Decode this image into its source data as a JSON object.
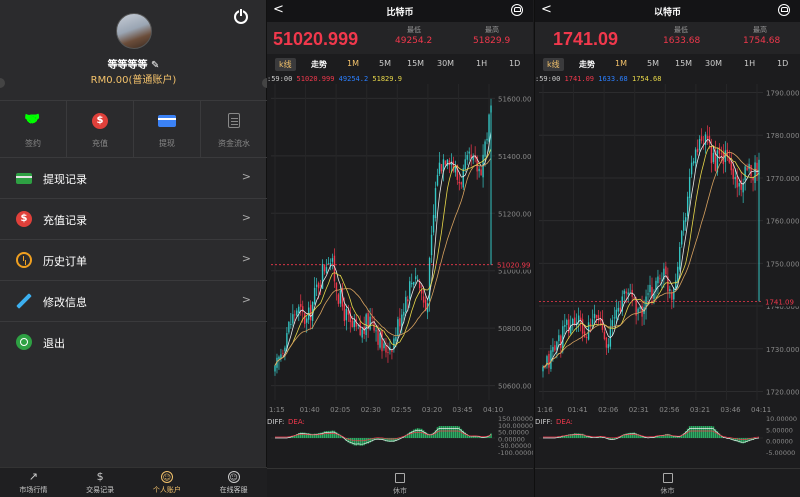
{
  "account": {
    "username": "等等等等 ✎",
    "balance": "RM0.00(普通账户)",
    "actions": [
      {
        "label": "签约",
        "icon": "handshake-icon"
      },
      {
        "label": "充值",
        "icon": "dollar-icon"
      },
      {
        "label": "提现",
        "icon": "card-icon"
      },
      {
        "label": "资金流水",
        "icon": "document-icon"
      }
    ],
    "menu": [
      {
        "label": "提现记录",
        "icon": "card-icon"
      },
      {
        "label": "充值记录",
        "icon": "dollar-icon"
      },
      {
        "label": "历史订单",
        "icon": "clock-icon"
      },
      {
        "label": "修改信息",
        "icon": "pen-icon"
      },
      {
        "label": "退出",
        "icon": "power-icon"
      }
    ],
    "chevron": ">",
    "tabs": [
      {
        "label": "市场行情",
        "glyph": "↗"
      },
      {
        "label": "交易记录",
        "glyph": "$"
      },
      {
        "label": "个人账户",
        "glyph": "☺",
        "active": true
      },
      {
        "label": "在线客服",
        "glyph": "☺"
      }
    ]
  },
  "panels": [
    {
      "back": "<",
      "title": "比特币",
      "price": "51020.999",
      "low_label": "最低",
      "low": "49254.2",
      "high_label": "最高",
      "high": "51829.9",
      "timeframes": [
        "k线",
        "走势",
        "1M",
        "5M",
        "15M",
        "30M",
        "1H",
        "1D"
      ],
      "active_timeframe": "1M",
      "legend": {
        "time": ":59:00",
        "a": "51020.999",
        "b": "49254.2",
        "c": "51829.9"
      },
      "bottom_label": "休市",
      "chart_data": {
        "type": "candlestick",
        "ylim": [
          50550,
          51650
        ],
        "y_ticks": [
          "51600.00",
          "51400.00",
          "51200.00",
          "51000.00",
          "50800.00",
          "50600.00"
        ],
        "x_ticks": [
          "1:15",
          "01:40",
          "02:05",
          "02:30",
          "02:55",
          "03:20",
          "03:45",
          "04:10"
        ],
        "last_price_label": "51020.99",
        "last_price": 51020.999,
        "macd_label": "DIFF:",
        "dea_label": "DEA:",
        "macd_ticks": [
          "150.00000",
          "100.00000",
          "50.00000",
          "0.00000",
          "-50.00000",
          "-100.00000"
        ],
        "path": [
          50640,
          50780,
          50870,
          50820,
          50960,
          51060,
          50900,
          50800,
          50780,
          50850,
          50720,
          50760,
          50900,
          51000,
          50860,
          51350,
          51420,
          51310,
          51380,
          51350,
          51560
        ]
      }
    },
    {
      "back": "<",
      "title": "以特币",
      "price": "1741.09",
      "low_label": "最低",
      "low": "1633.68",
      "high_label": "最高",
      "high": "1754.68",
      "timeframes": [
        "k线",
        "走势",
        "1M",
        "5M",
        "15M",
        "30M",
        "1H",
        "1D"
      ],
      "active_timeframe": "1M",
      "legend": {
        "time": ":59:00",
        "a": "1741.09",
        "b": "1633.68",
        "c": "1754.68"
      },
      "bottom_label": "休市",
      "chart_data": {
        "type": "candlestick",
        "ylim": [
          1718,
          1792
        ],
        "y_ticks": [
          "1790.000",
          "1780.000",
          "1770.000",
          "1760.000",
          "1750.000",
          "1740.000",
          "1730.000",
          "1720.000"
        ],
        "x_ticks": [
          "1:16",
          "01:41",
          "02:06",
          "02:31",
          "02:56",
          "03:21",
          "03:46",
          "04:11"
        ],
        "last_price_label": "1741.09",
        "last_price": 1741.09,
        "macd_label": "DIFF:",
        "dea_label": "DEA:",
        "macd_ticks": [
          "10.00000",
          "5.00000",
          "0.00000",
          "-5.00000"
        ],
        "path": [
          1724,
          1730,
          1734,
          1737,
          1733,
          1738,
          1732,
          1740,
          1744,
          1738,
          1743,
          1748,
          1743,
          1760,
          1776,
          1778,
          1774,
          1775,
          1768,
          1771,
          1773
        ]
      }
    }
  ],
  "colors": {
    "up": "#f0384c",
    "down": "#35c6c4",
    "accent": "#f3c26b"
  }
}
